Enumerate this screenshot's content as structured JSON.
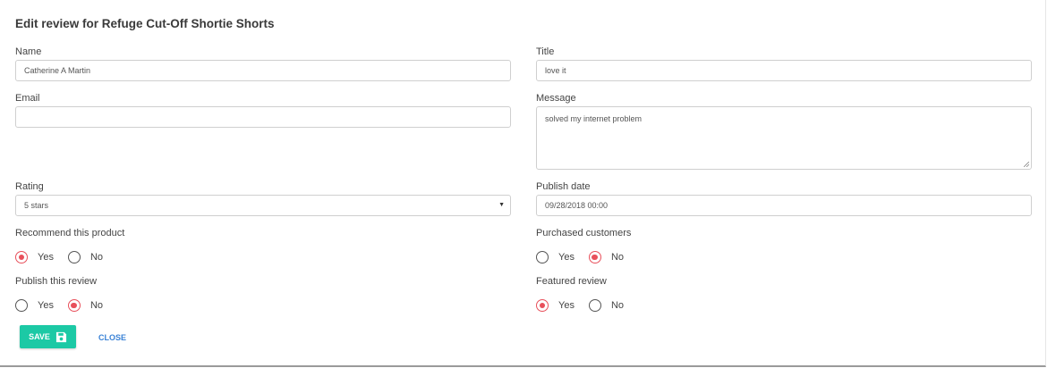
{
  "dialog": {
    "title": "Edit review for Refuge Cut-Off Shortie Shorts"
  },
  "fields": {
    "name": {
      "label": "Name",
      "value": "Catherine A Martin"
    },
    "title": {
      "label": "Title",
      "value": "love it"
    },
    "email": {
      "label": "Email",
      "value": ""
    },
    "message": {
      "label": "Message",
      "value": "solved my internet problem"
    },
    "rating": {
      "label": "Rating",
      "value": "5 stars"
    },
    "publish_date": {
      "label": "Publish date",
      "value": "09/28/2018 00:00"
    }
  },
  "radios": {
    "recommend": {
      "label": "Recommend this product",
      "yes": "Yes",
      "no": "No",
      "selected": "yes"
    },
    "purchased": {
      "label": "Purchased customers",
      "yes": "Yes",
      "no": "No",
      "selected": "no"
    },
    "publish": {
      "label": "Publish this review",
      "yes": "Yes",
      "no": "No",
      "selected": "no"
    },
    "featured": {
      "label": "Featured review",
      "yes": "Yes",
      "no": "No",
      "selected": "yes"
    }
  },
  "actions": {
    "save_label": "SAVE",
    "close_label": "CLOSE",
    "save_icon": "floppy-disk-icon"
  },
  "colors": {
    "accent": "#1cc9a5",
    "radio_selected": "#e8505b",
    "link": "#3a82d6"
  }
}
